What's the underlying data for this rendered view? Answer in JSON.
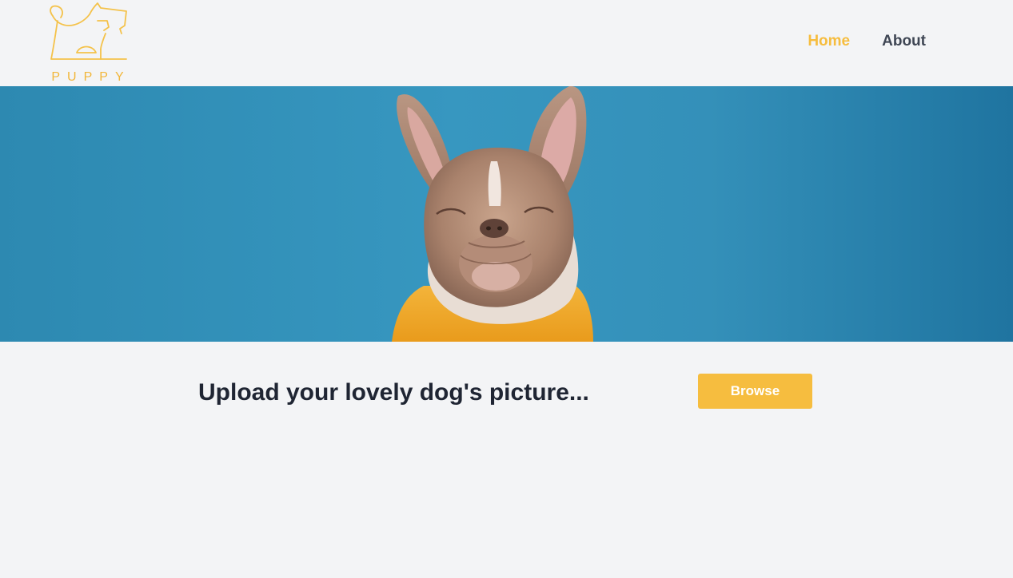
{
  "brand": {
    "logo_icon": "dog-outline-logo-icon",
    "name": "PUPPY",
    "color": "#f6bd3f"
  },
  "nav": {
    "items": [
      {
        "label": "Home",
        "active": true
      },
      {
        "label": "About",
        "active": false
      }
    ],
    "active_color": "#f6bd3f",
    "text_color": "#3f4654"
  },
  "hero": {
    "image": "french-bulldog-in-yellow-hoodie-photo",
    "background_color": "#3493bb"
  },
  "upload": {
    "title": "Upload your lovely dog's picture...",
    "button_label": "Browse"
  }
}
